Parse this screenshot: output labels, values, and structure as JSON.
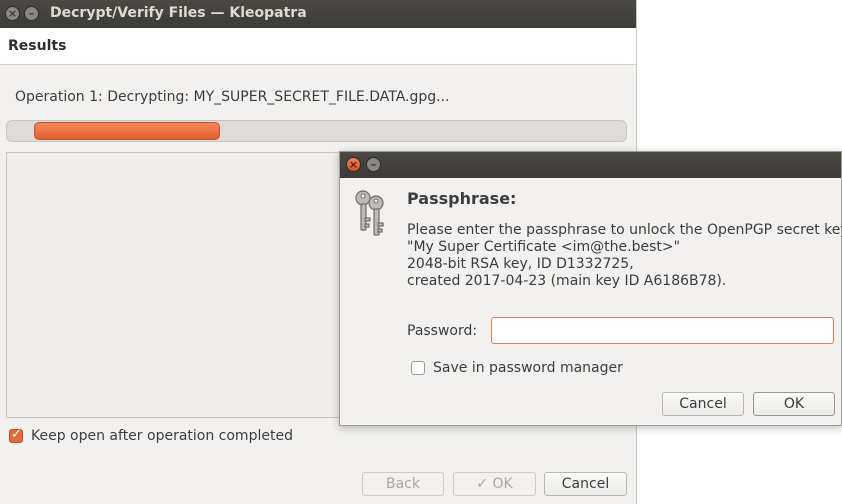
{
  "main_window": {
    "title": "Decrypt/Verify Files — Kleopatra",
    "header_label": "Results",
    "operation_text": "Operation 1: Decrypting: MY_SUPER_SECRET_FILE.DATA.gpg...",
    "progress_fraction": 0.33,
    "keep_open_label": "Keep open after operation completed",
    "keep_open_checked": true,
    "buttons": {
      "back": "Back",
      "ok": "OK",
      "cancel": "Cancel"
    }
  },
  "dialog": {
    "heading": "Passphrase:",
    "message_lines": [
      "Please enter the passphrase to unlock the OpenPGP secret key:",
      "\"My Super Certificate <im@the.best>\"",
      "2048-bit RSA key, ID D1332725,",
      "created 2017-04-23 (main key ID A6186B78)."
    ],
    "password_label": "Password:",
    "password_value": "",
    "save_label": "Save in password manager",
    "save_checked": false,
    "buttons": {
      "cancel": "Cancel",
      "ok": "OK"
    }
  },
  "icons": {
    "close": "close-icon",
    "minimize": "minimize-icon",
    "keys": "keys-icon",
    "check": "checkmark-icon"
  },
  "colors": {
    "accent": "#e25d2c",
    "titlebar": "#3c3b37"
  }
}
